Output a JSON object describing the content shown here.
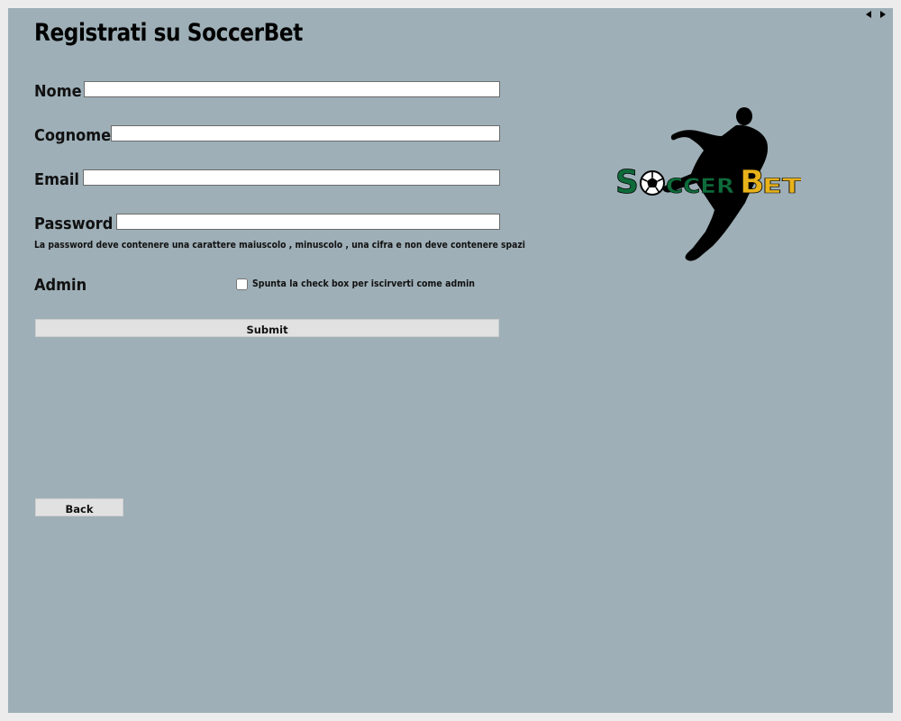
{
  "title": "Registrati su SoccerBet",
  "form": {
    "nome_label": "Nome",
    "nome_value": "",
    "cognome_label": "Cognome",
    "cognome_value": "",
    "email_label": "Email",
    "email_value": "",
    "password_label": "Password",
    "password_value": "",
    "password_hint": "La password deve contenere una carattere maiuscolo , minuscolo , una cifra e non deve contenere spazi",
    "admin_label": "Admin",
    "admin_checked": false,
    "admin_checkbox_label": "Spunta la check box per iscirverti come admin",
    "submit_label": "Submit",
    "back_label": "Back"
  },
  "nav": {
    "prev_icon": "triangle-left-icon",
    "next_icon": "triangle-right-icon"
  },
  "logo": {
    "text_part1": "SoccerB",
    "text_part2": "et",
    "soccer_letters": [
      "S",
      "CCER"
    ],
    "bet_letters": [
      "B",
      "ET"
    ],
    "colors": {
      "soccer": "#0e6b3a",
      "bet": "#e8b21a",
      "silhouette": "#000000"
    }
  },
  "colors": {
    "background": "#9eafb7",
    "outer": "#ececec",
    "button": "#e1e1e1"
  }
}
